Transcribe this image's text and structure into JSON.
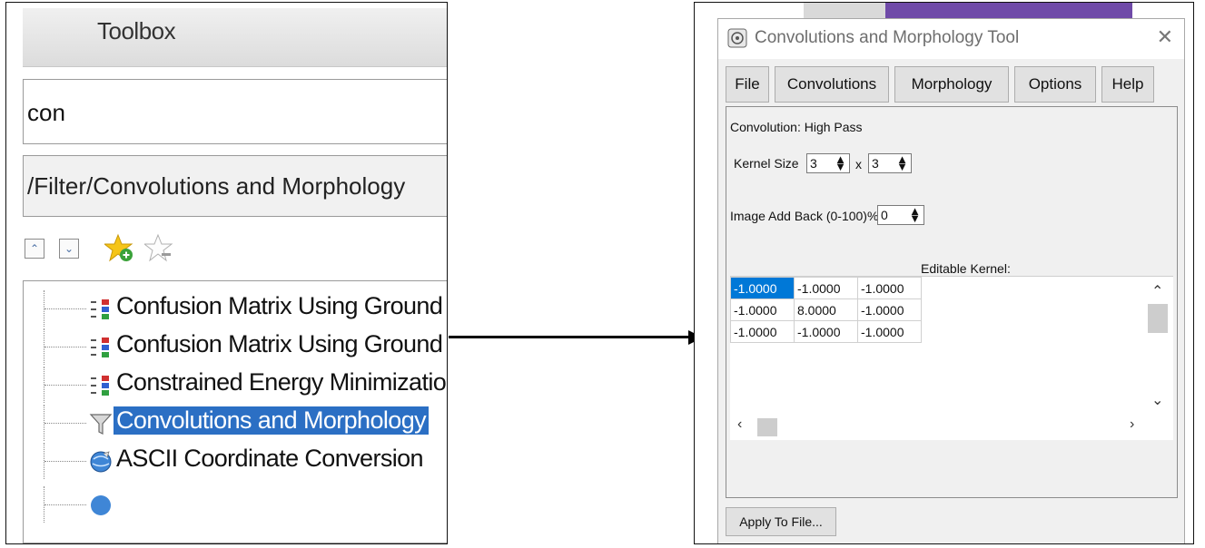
{
  "toolbox": {
    "title": "Toolbox",
    "search_value": "con",
    "path": "/Filter/Convolutions and Morphology",
    "tree": [
      {
        "label": "Confusion Matrix Using Ground Truth",
        "icon": "tool-icon"
      },
      {
        "label": "Confusion Matrix Using Ground Truth",
        "icon": "tool-icon"
      },
      {
        "label": "Constrained Energy Minimization Cla",
        "icon": "tool-icon"
      },
      {
        "label": "Convolutions and Morphology",
        "icon": "filter-funnel-icon",
        "selected": true
      },
      {
        "label": "ASCII Coordinate Conversion",
        "icon": "globe-icon"
      }
    ]
  },
  "dialog": {
    "title": "Convolutions and Morphology Tool",
    "close_glyph": "✕",
    "menu": [
      "File",
      "Convolutions",
      "Morphology",
      "Options",
      "Help"
    ],
    "convolution_label": "Convolution: High Pass",
    "kernel_size_label": "Kernel Size",
    "kernel_size_x": "3",
    "kernel_size_sep": "x",
    "kernel_size_y": "3",
    "add_back_label": "Image Add Back (0-100)%",
    "add_back_value": "0",
    "editable_kernel_label": "Editable Kernel:",
    "kernel": [
      [
        "-1.0000",
        "-1.0000",
        "-1.0000"
      ],
      [
        "-1.0000",
        "8.0000",
        "-1.0000"
      ],
      [
        "-1.0000",
        "-1.0000",
        "-1.0000"
      ]
    ],
    "apply_button": "Apply To File..."
  },
  "colors": {
    "selection": "#2b6fc4",
    "cell_selection": "#0078d7",
    "background_strip": "#6f4aa8"
  }
}
